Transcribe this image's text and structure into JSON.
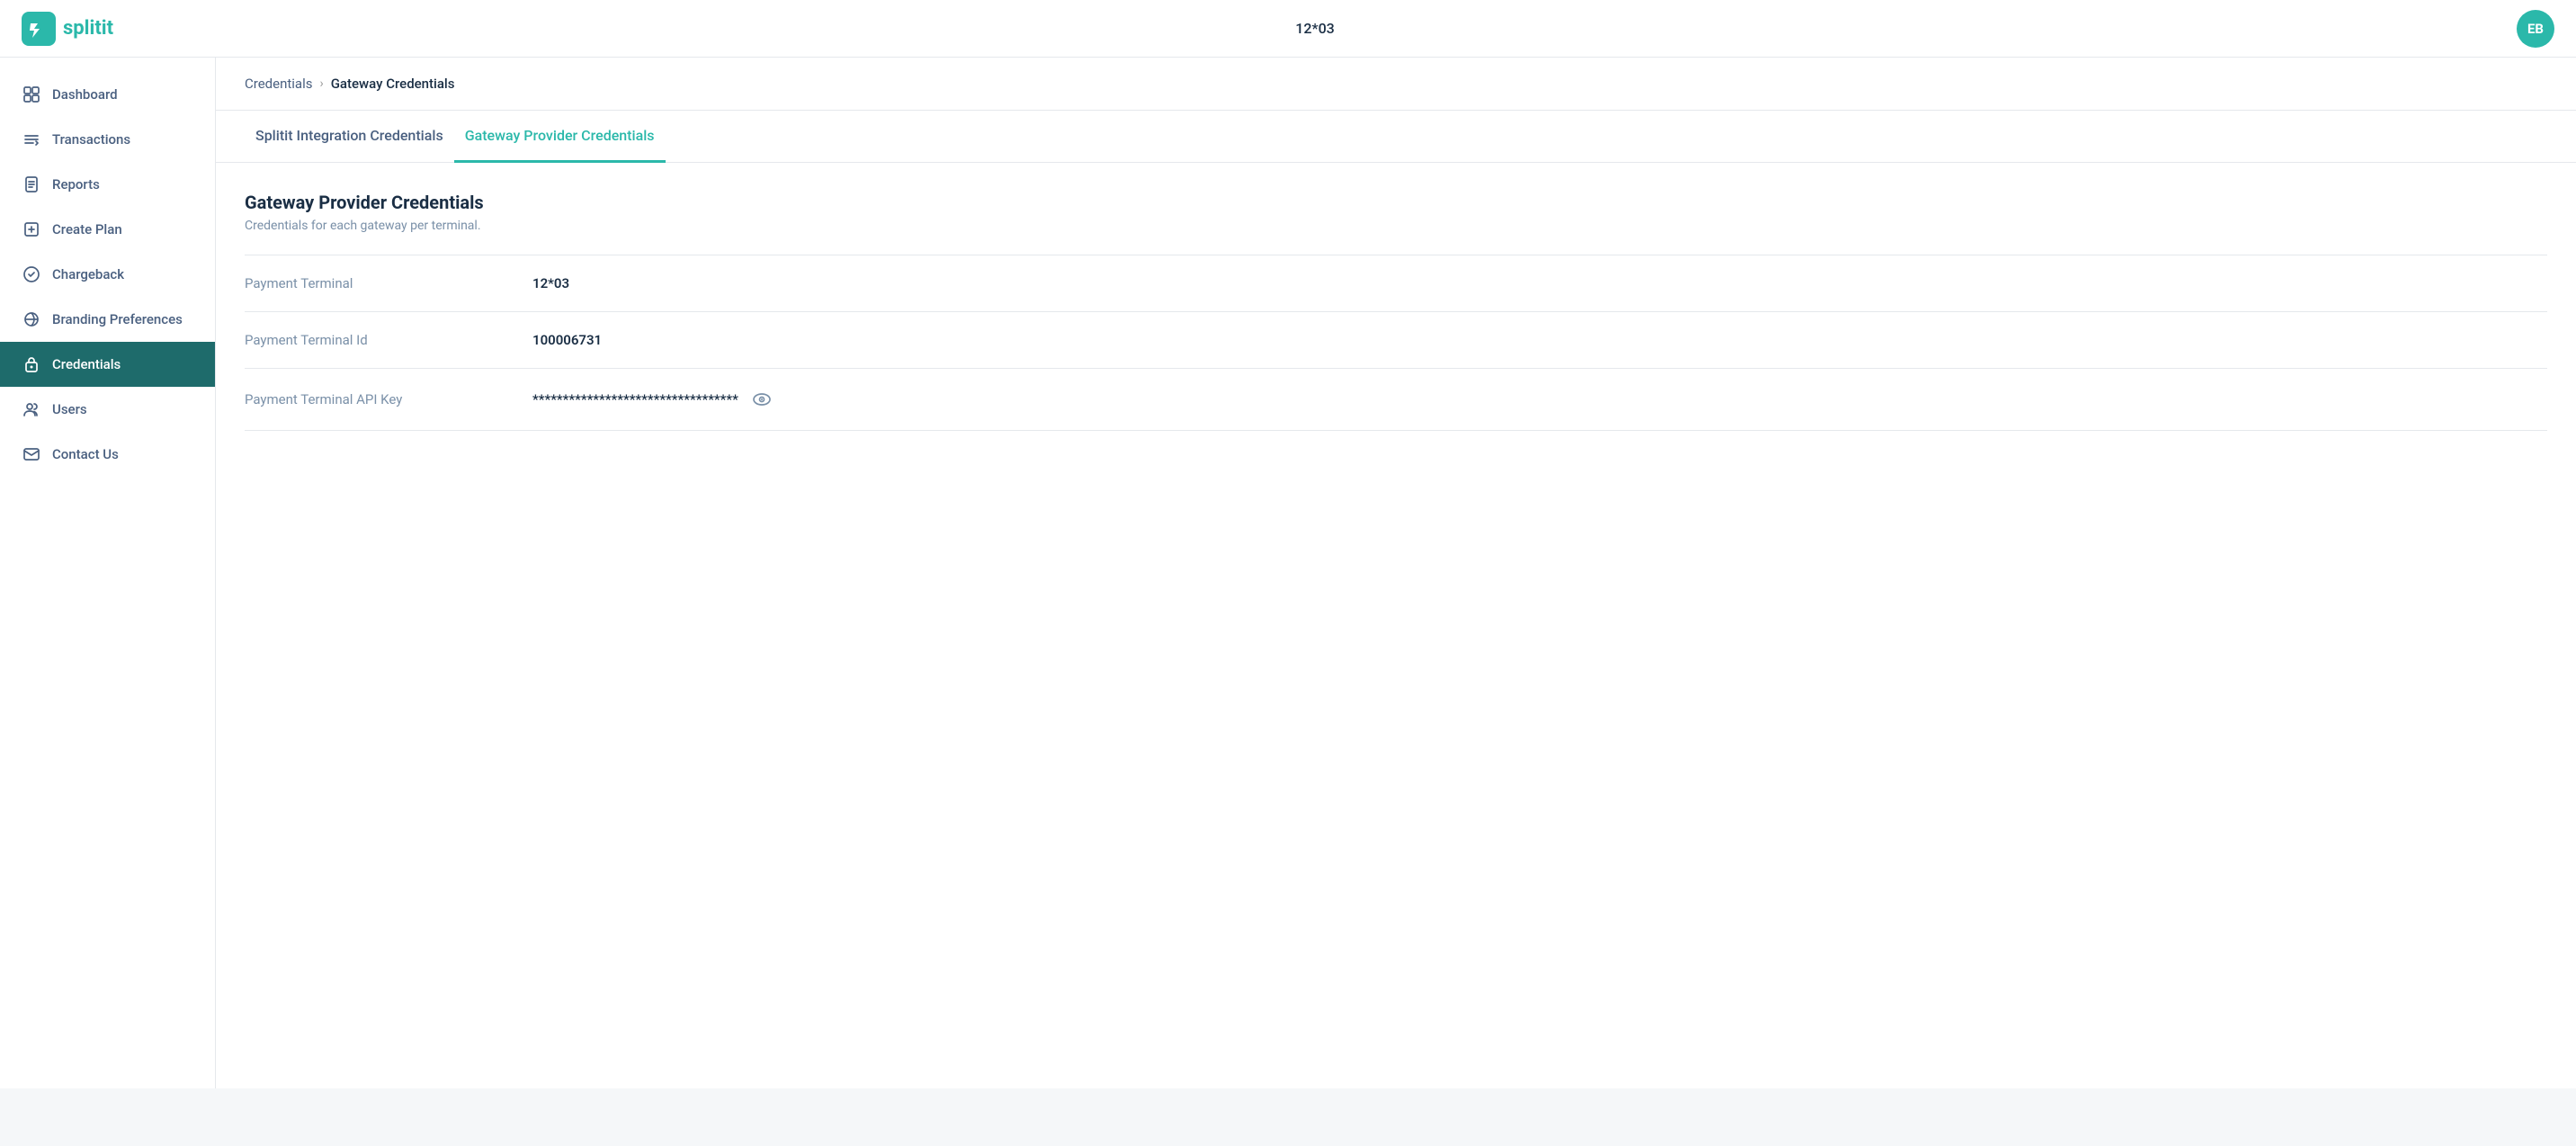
{
  "header": {
    "title": "12*03",
    "avatar_initials": "EB",
    "logo_text_dark": "split",
    "logo_text_accent": "it"
  },
  "breadcrumb": {
    "items": [
      {
        "label": "Credentials",
        "current": false
      },
      {
        "label": "Gateway Credentials",
        "current": true
      }
    ]
  },
  "tabs": [
    {
      "label": "Splitit Integration Credentials",
      "active": false
    },
    {
      "label": "Gateway Provider Credentials",
      "active": true
    }
  ],
  "section": {
    "title": "Gateway Provider Credentials",
    "description": "Credentials for each gateway per terminal."
  },
  "fields": [
    {
      "label": "Payment Terminal",
      "value": "12*03"
    },
    {
      "label": "Payment Terminal Id",
      "value": "100006731"
    },
    {
      "label": "Payment Terminal API Key",
      "value": "**********************************",
      "masked": true
    }
  ],
  "sidebar": {
    "items": [
      {
        "label": "Dashboard",
        "icon": "dashboard",
        "active": false
      },
      {
        "label": "Transactions",
        "icon": "transactions",
        "active": false
      },
      {
        "label": "Reports",
        "icon": "reports",
        "active": false
      },
      {
        "label": "Create Plan",
        "icon": "create-plan",
        "active": false
      },
      {
        "label": "Chargeback",
        "icon": "chargeback",
        "active": false
      },
      {
        "label": "Branding Preferences",
        "icon": "branding",
        "active": false
      },
      {
        "label": "Credentials",
        "icon": "credentials",
        "active": true
      },
      {
        "label": "Users",
        "icon": "users",
        "active": false
      },
      {
        "label": "Contact Us",
        "icon": "contact",
        "active": false
      }
    ]
  }
}
